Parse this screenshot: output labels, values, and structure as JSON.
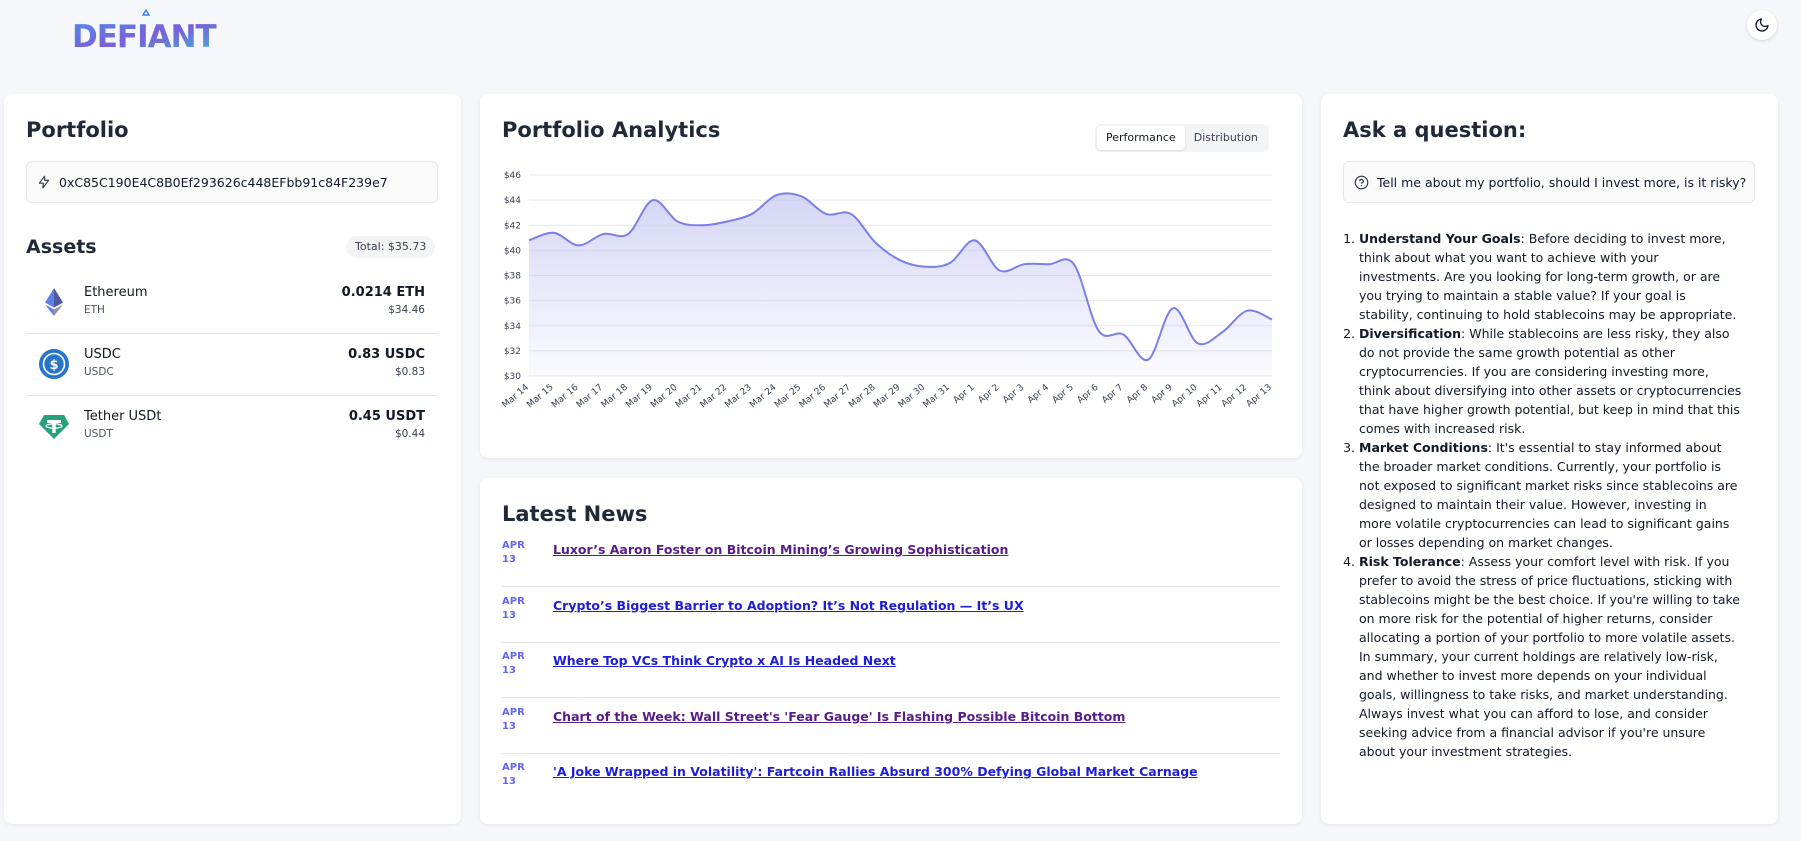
{
  "header": {
    "logo_text": "DEFIANT",
    "theme_toggle_icon": "moon-icon"
  },
  "portfolio": {
    "title": "Portfolio",
    "address_icon": "lightning-icon",
    "address": "0xC85C190E4C8B0Ef293626c448EFbb91c84F239e7",
    "assets_title": "Assets",
    "total": "Total: $35.73",
    "assets": [
      {
        "name": "Ethereum",
        "symbol": "ETH",
        "amount": "0.0214 ETH",
        "usd": "$34.46",
        "icon": "ethereum-icon",
        "color": "#627eea"
      },
      {
        "name": "USDC",
        "symbol": "USDC",
        "amount": "0.83 USDC",
        "usd": "$0.83",
        "icon": "usdc-icon",
        "color": "#2775ca"
      },
      {
        "name": "Tether USDt",
        "symbol": "USDT",
        "amount": "0.45 USDT",
        "usd": "$0.44",
        "icon": "tether-icon",
        "color": "#26a17b"
      }
    ]
  },
  "analytics": {
    "title": "Portfolio Analytics",
    "tabs": [
      {
        "label": "Performance",
        "active": true
      },
      {
        "label": "Distribution",
        "active": false
      }
    ]
  },
  "chart_data": {
    "type": "area",
    "x": [
      "Mar 14",
      "Mar 15",
      "Mar 16",
      "Mar 17",
      "Mar 18",
      "Mar 19",
      "Mar 20",
      "Mar 21",
      "Mar 22",
      "Mar 23",
      "Mar 24",
      "Mar 25",
      "Mar 26",
      "Mar 27",
      "Mar 28",
      "Mar 29",
      "Mar 30",
      "Mar 31",
      "Apr 1",
      "Apr 2",
      "Apr 3",
      "Apr 4",
      "Apr 5",
      "Apr 6",
      "Apr 7",
      "Apr 8",
      "Apr 9",
      "Apr 10",
      "Apr 11",
      "Apr 12",
      "Apr 13"
    ],
    "values": [
      40.8,
      41.4,
      40.4,
      41.3,
      41.3,
      44.0,
      42.3,
      42.0,
      42.3,
      42.9,
      44.4,
      44.3,
      42.9,
      42.9,
      40.6,
      39.2,
      38.7,
      39.0,
      40.8,
      38.4,
      38.9,
      38.9,
      38.9,
      33.6,
      33.3,
      31.3,
      35.4,
      32.6,
      33.5,
      35.2,
      34.5
    ],
    "ylim": [
      30,
      46
    ],
    "yticks": [
      "$30",
      "$32",
      "$34",
      "$36",
      "$38",
      "$40",
      "$42",
      "$44",
      "$46"
    ],
    "line_color": "#7b7fe8",
    "fill_color": "#c7c8f3",
    "grid": true
  },
  "news": {
    "title": "Latest News",
    "items": [
      {
        "month": "APR",
        "day": "13",
        "title": "Luxor’s Aaron Foster on Bitcoin Mining’s Growing Sophistication",
        "visited": true
      },
      {
        "month": "APR",
        "day": "13",
        "title": "Crypto’s Biggest Barrier to Adoption? It’s Not Regulation — It’s UX",
        "visited": false
      },
      {
        "month": "APR",
        "day": "13",
        "title": "Where Top VCs Think Crypto x AI Is Headed Next",
        "visited": false
      },
      {
        "month": "APR",
        "day": "13",
        "title": "Chart of the Week: Wall Street's 'Fear Gauge' Is Flashing Possible Bitcoin Bottom",
        "visited": true
      },
      {
        "month": "APR",
        "day": "13",
        "title": "'A Joke Wrapped in Volatility': Fartcoin Rallies Absurd 300% Defying Global Market Carnage",
        "visited": false
      }
    ]
  },
  "ask": {
    "title": "Ask a question:",
    "input_icon": "help-circle-icon",
    "question": "Tell me about my portfolio, should I invest more, is it risky?",
    "answer_items": [
      {
        "heading": "Understand Your Goals",
        "text": ": Before deciding to invest more, think about what you want to achieve with your investments. Are you looking for long-term growth, or are you trying to maintain a stable value? If your goal is stability, continuing to hold stablecoins may be appropriate."
      },
      {
        "heading": "Diversification",
        "text": ": While stablecoins are less risky, they also do not provide the same growth potential as other cryptocurrencies. If you are considering investing more, think about diversifying into other assets or cryptocurrencies that have higher growth potential, but keep in mind that this comes with increased risk."
      },
      {
        "heading": "Market Conditions",
        "text": ": It's essential to stay informed about the broader market conditions. Currently, your portfolio is not exposed to significant market risks since stablecoins are designed to maintain their value. However, investing in more volatile cryptocurrencies can lead to significant gains or losses depending on market changes."
      },
      {
        "heading": "Risk Tolerance",
        "text": ": Assess your comfort level with risk. If you prefer to avoid the stress of price fluctuations, sticking with stablecoins might be the best choice. If you're willing to take on more risk for the potential of higher returns, consider allocating a portion of your portfolio to more volatile assets."
      }
    ],
    "summary": "In summary, your current holdings are relatively low-risk, and whether to invest more depends on your individual goals, willingness to take risks, and market understanding. Always invest what you can afford to lose, and consider seeking advice from a financial advisor if you're unsure about your investment strategies."
  }
}
